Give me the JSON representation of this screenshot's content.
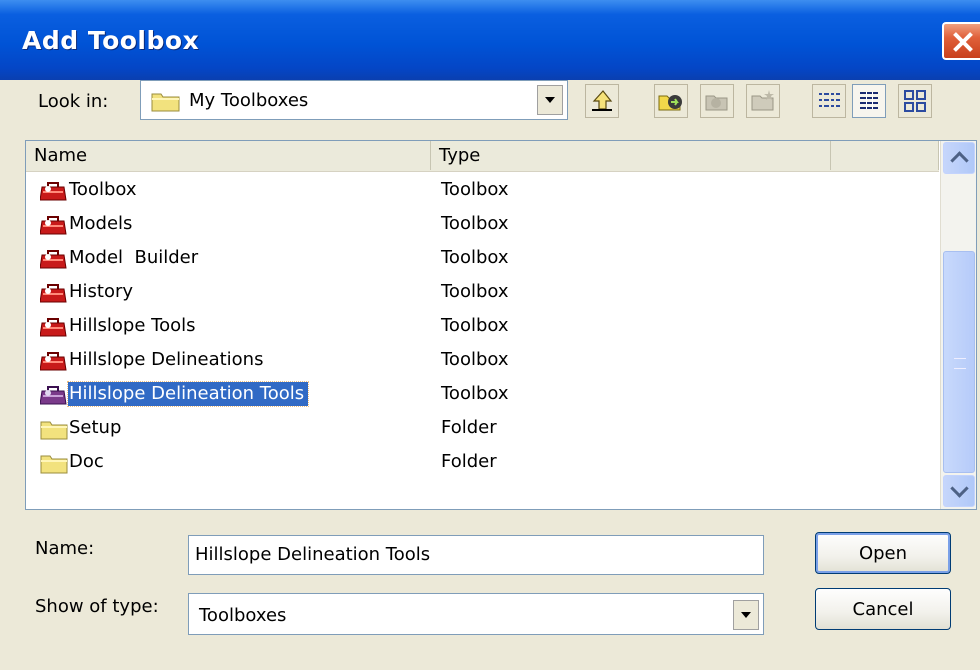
{
  "window": {
    "title": "Add Toolbox"
  },
  "toolbar": {
    "look_in_label": "Look in:",
    "look_in_value": "My Toolboxes",
    "buttons": [
      "up-one-level",
      "connect-to-folder",
      "disconnect-folder",
      "new-folder",
      "list-view",
      "details-view",
      "thumbnails-view"
    ]
  },
  "list": {
    "columns": [
      "Name",
      "Type"
    ],
    "items": [
      {
        "name": "Toolbox",
        "type": "Toolbox",
        "icon": "toolbox-icon"
      },
      {
        "name": "Models",
        "type": "Toolbox",
        "icon": "toolbox-icon"
      },
      {
        "name": "Model  Builder",
        "type": "Toolbox",
        "icon": "toolbox-icon"
      },
      {
        "name": "History",
        "type": "Toolbox",
        "icon": "toolbox-icon"
      },
      {
        "name": "Hillslope Tools",
        "type": "Toolbox",
        "icon": "toolbox-icon"
      },
      {
        "name": "Hillslope Delineations",
        "type": "Toolbox",
        "icon": "toolbox-icon"
      },
      {
        "name": "Hillslope Delineation Tools",
        "type": "Toolbox",
        "icon": "toolbox-icon",
        "selected": true
      },
      {
        "name": "Setup",
        "type": "Folder",
        "icon": "folder-icon"
      },
      {
        "name": "Doc",
        "type": "Folder",
        "icon": "folder-icon"
      }
    ]
  },
  "form": {
    "name_label": "Name:",
    "name_value": "Hillslope Delineation Tools",
    "type_label": "Show of type:",
    "type_value": "Toolboxes",
    "open_label": "Open",
    "cancel_label": "Cancel"
  },
  "colors": {
    "titlebar": "#0053d6",
    "selection": "#316ac5",
    "dialog_bg": "#ece9d8"
  }
}
